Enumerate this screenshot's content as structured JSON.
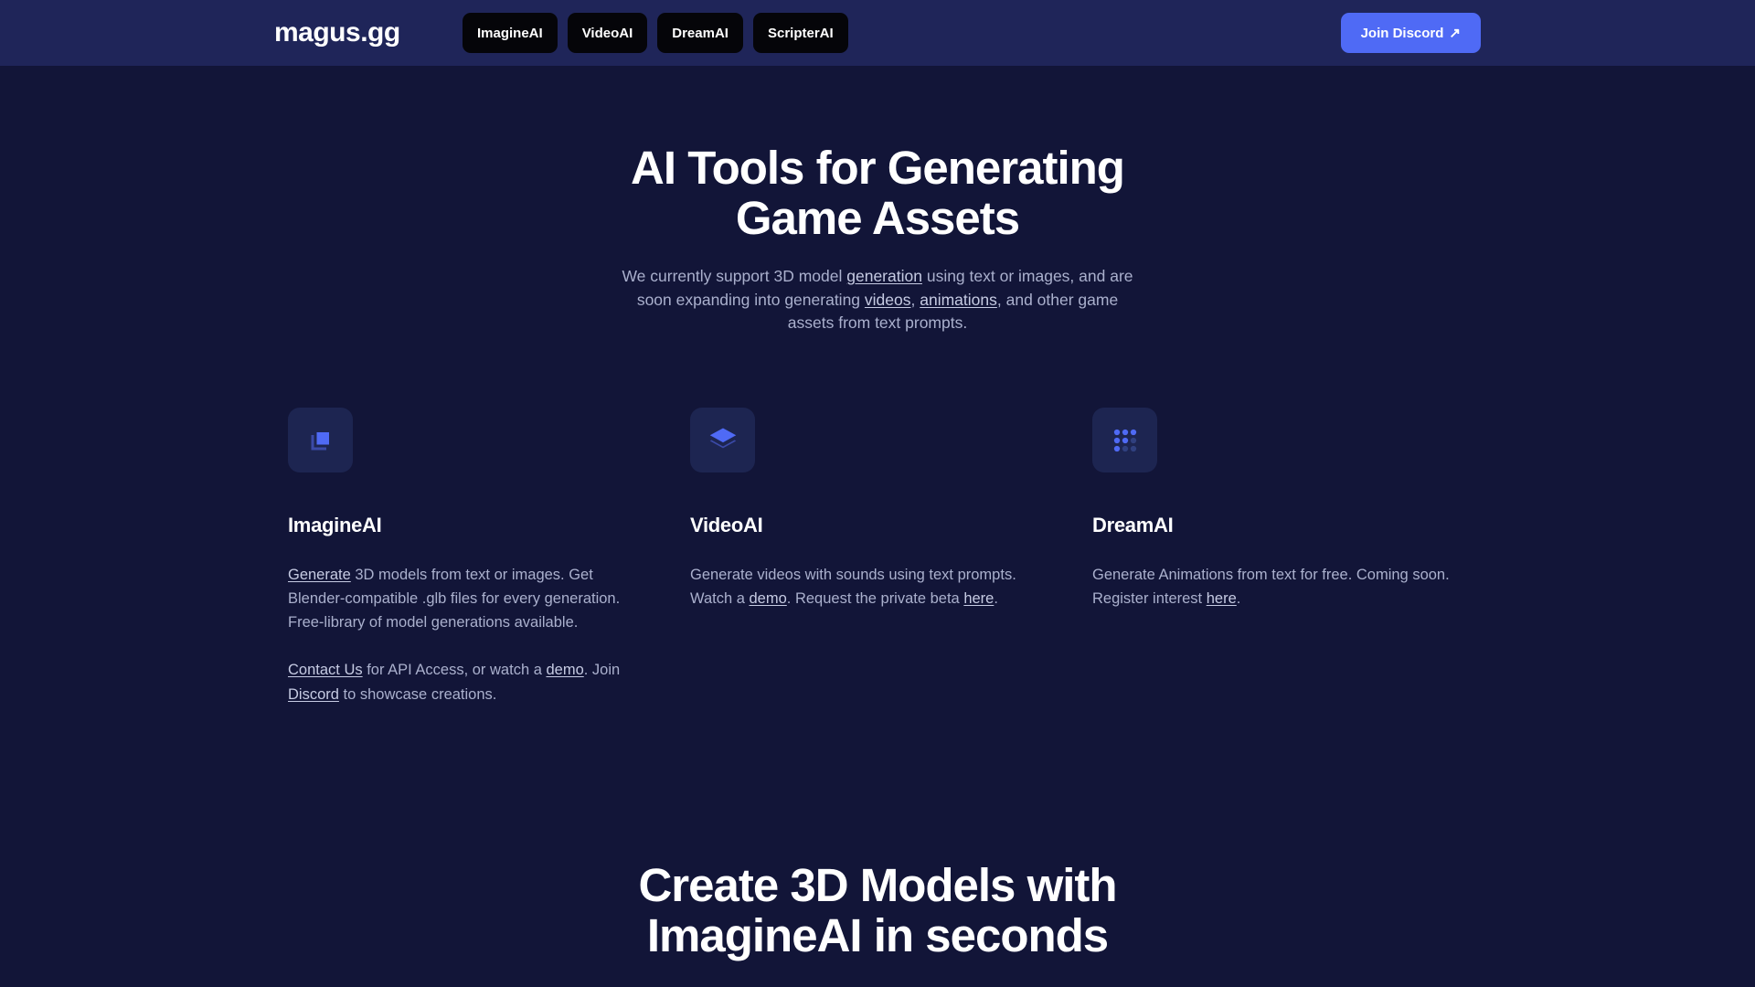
{
  "header": {
    "brand": "magus.gg",
    "nav_items": [
      {
        "label": "ImagineAI"
      },
      {
        "label": "VideoAI"
      },
      {
        "label": "DreamAI"
      },
      {
        "label": "ScripterAI"
      }
    ],
    "cta": {
      "label": "Join Discord",
      "arrow": "↗"
    },
    "colors": {
      "background": "#1f2559",
      "cta_background": "#4f6af5",
      "nav_background": "#050509"
    }
  },
  "hero": {
    "title_line1": "AI Tools for Generating",
    "title_line2": "Game Assets",
    "subtitle": {
      "s1": "We currently support 3D model ",
      "link1": "generation",
      "s2": " using text or images, and are soon expanding into generating ",
      "link2": "videos",
      "s3": ", ",
      "link3": "animations",
      "s4": ", and other game assets from text prompts."
    }
  },
  "cards": [
    {
      "icon": "copy-squares-icon",
      "title": "ImagineAI",
      "p1": {
        "link1": "Generate",
        "s1": " 3D models from text or images. Get Blender-compatible .glb files for every generation. Free-library of model generations available."
      },
      "p2": {
        "link1": "Contact Us",
        "s1": " for API Access, or watch a ",
        "link2": "demo",
        "s2": ". Join ",
        "link3": "Discord",
        "s3": " to showcase creations."
      }
    },
    {
      "icon": "layers-stack-icon",
      "title": "VideoAI",
      "p1": {
        "s0": "Generate videos with sounds using text prompts. Watch a ",
        "link1": "demo",
        "s1": ". Request the private beta ",
        "link2": "here",
        "s2": "."
      }
    },
    {
      "icon": "dot-grid-icon",
      "title": "DreamAI",
      "p1": {
        "s0": "Generate Animations from text for free. Coming soon. Register interest ",
        "link1": "here",
        "s1": "."
      }
    }
  ],
  "bottom": {
    "title_line1": "Create 3D Models with",
    "title_line2": "ImagineAI in seconds"
  },
  "theme": {
    "page_background": "#121538",
    "accent_blue": "#4f6af5",
    "body_text": "#aab0cd",
    "heading_text": "#ffffff"
  }
}
